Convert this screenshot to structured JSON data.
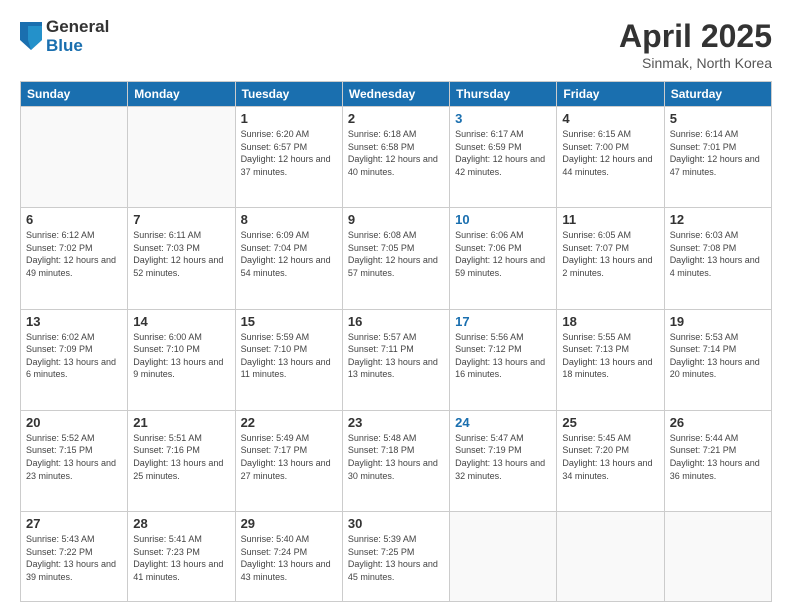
{
  "header": {
    "logo_general": "General",
    "logo_blue": "Blue",
    "title": "April 2025",
    "subtitle": "Sinmak, North Korea"
  },
  "days_of_week": [
    "Sunday",
    "Monday",
    "Tuesday",
    "Wednesday",
    "Thursday",
    "Friday",
    "Saturday"
  ],
  "weeks": [
    [
      {
        "day": "",
        "info": ""
      },
      {
        "day": "",
        "info": ""
      },
      {
        "day": "1",
        "info": "Sunrise: 6:20 AM\nSunset: 6:57 PM\nDaylight: 12 hours and 37 minutes."
      },
      {
        "day": "2",
        "info": "Sunrise: 6:18 AM\nSunset: 6:58 PM\nDaylight: 12 hours and 40 minutes."
      },
      {
        "day": "3",
        "info": "Sunrise: 6:17 AM\nSunset: 6:59 PM\nDaylight: 12 hours and 42 minutes.",
        "thursday": true
      },
      {
        "day": "4",
        "info": "Sunrise: 6:15 AM\nSunset: 7:00 PM\nDaylight: 12 hours and 44 minutes."
      },
      {
        "day": "5",
        "info": "Sunrise: 6:14 AM\nSunset: 7:01 PM\nDaylight: 12 hours and 47 minutes."
      }
    ],
    [
      {
        "day": "6",
        "info": "Sunrise: 6:12 AM\nSunset: 7:02 PM\nDaylight: 12 hours and 49 minutes."
      },
      {
        "day": "7",
        "info": "Sunrise: 6:11 AM\nSunset: 7:03 PM\nDaylight: 12 hours and 52 minutes."
      },
      {
        "day": "8",
        "info": "Sunrise: 6:09 AM\nSunset: 7:04 PM\nDaylight: 12 hours and 54 minutes."
      },
      {
        "day": "9",
        "info": "Sunrise: 6:08 AM\nSunset: 7:05 PM\nDaylight: 12 hours and 57 minutes."
      },
      {
        "day": "10",
        "info": "Sunrise: 6:06 AM\nSunset: 7:06 PM\nDaylight: 12 hours and 59 minutes.",
        "thursday": true
      },
      {
        "day": "11",
        "info": "Sunrise: 6:05 AM\nSunset: 7:07 PM\nDaylight: 13 hours and 2 minutes."
      },
      {
        "day": "12",
        "info": "Sunrise: 6:03 AM\nSunset: 7:08 PM\nDaylight: 13 hours and 4 minutes."
      }
    ],
    [
      {
        "day": "13",
        "info": "Sunrise: 6:02 AM\nSunset: 7:09 PM\nDaylight: 13 hours and 6 minutes."
      },
      {
        "day": "14",
        "info": "Sunrise: 6:00 AM\nSunset: 7:10 PM\nDaylight: 13 hours and 9 minutes."
      },
      {
        "day": "15",
        "info": "Sunrise: 5:59 AM\nSunset: 7:10 PM\nDaylight: 13 hours and 11 minutes."
      },
      {
        "day": "16",
        "info": "Sunrise: 5:57 AM\nSunset: 7:11 PM\nDaylight: 13 hours and 13 minutes."
      },
      {
        "day": "17",
        "info": "Sunrise: 5:56 AM\nSunset: 7:12 PM\nDaylight: 13 hours and 16 minutes.",
        "thursday": true
      },
      {
        "day": "18",
        "info": "Sunrise: 5:55 AM\nSunset: 7:13 PM\nDaylight: 13 hours and 18 minutes."
      },
      {
        "day": "19",
        "info": "Sunrise: 5:53 AM\nSunset: 7:14 PM\nDaylight: 13 hours and 20 minutes."
      }
    ],
    [
      {
        "day": "20",
        "info": "Sunrise: 5:52 AM\nSunset: 7:15 PM\nDaylight: 13 hours and 23 minutes."
      },
      {
        "day": "21",
        "info": "Sunrise: 5:51 AM\nSunset: 7:16 PM\nDaylight: 13 hours and 25 minutes."
      },
      {
        "day": "22",
        "info": "Sunrise: 5:49 AM\nSunset: 7:17 PM\nDaylight: 13 hours and 27 minutes."
      },
      {
        "day": "23",
        "info": "Sunrise: 5:48 AM\nSunset: 7:18 PM\nDaylight: 13 hours and 30 minutes."
      },
      {
        "day": "24",
        "info": "Sunrise: 5:47 AM\nSunset: 7:19 PM\nDaylight: 13 hours and 32 minutes.",
        "thursday": true
      },
      {
        "day": "25",
        "info": "Sunrise: 5:45 AM\nSunset: 7:20 PM\nDaylight: 13 hours and 34 minutes."
      },
      {
        "day": "26",
        "info": "Sunrise: 5:44 AM\nSunset: 7:21 PM\nDaylight: 13 hours and 36 minutes."
      }
    ],
    [
      {
        "day": "27",
        "info": "Sunrise: 5:43 AM\nSunset: 7:22 PM\nDaylight: 13 hours and 39 minutes."
      },
      {
        "day": "28",
        "info": "Sunrise: 5:41 AM\nSunset: 7:23 PM\nDaylight: 13 hours and 41 minutes."
      },
      {
        "day": "29",
        "info": "Sunrise: 5:40 AM\nSunset: 7:24 PM\nDaylight: 13 hours and 43 minutes."
      },
      {
        "day": "30",
        "info": "Sunrise: 5:39 AM\nSunset: 7:25 PM\nDaylight: 13 hours and 45 minutes."
      },
      {
        "day": "",
        "info": ""
      },
      {
        "day": "",
        "info": ""
      },
      {
        "day": "",
        "info": ""
      }
    ]
  ]
}
